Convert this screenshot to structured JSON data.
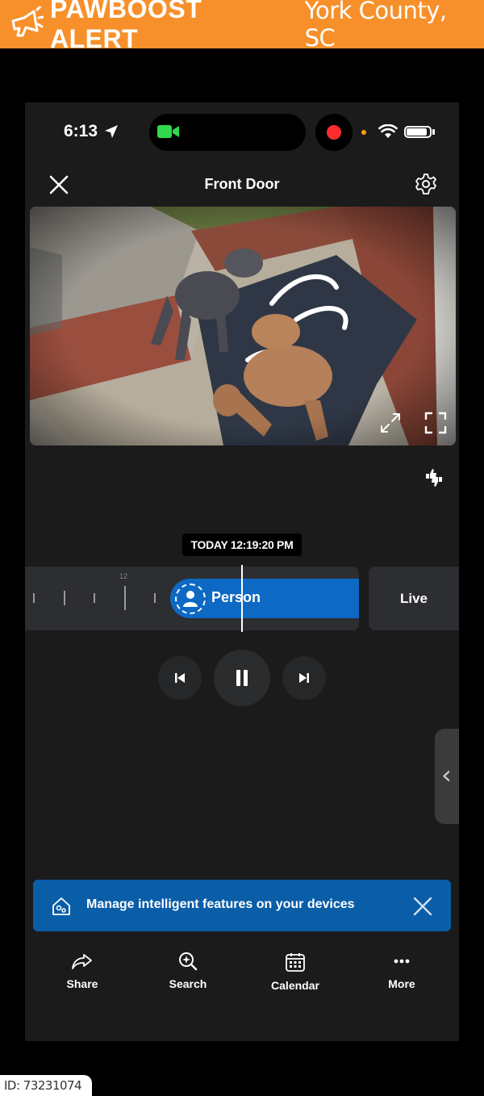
{
  "banner": {
    "brand": "PAWBOOST ALERT",
    "location": "York County, SC",
    "background": "#f7902a"
  },
  "status_bar": {
    "time": "6:13",
    "icons": [
      "location-arrow-icon",
      "facetime-camera-icon",
      "recording-dot-icon",
      "wifi-icon",
      "battery-icon"
    ]
  },
  "header": {
    "title": "Front Door",
    "close_icon": "close-icon",
    "settings_icon": "gear-icon"
  },
  "video": {
    "description_icons": [
      "expand-icon",
      "fullscreen-icon"
    ]
  },
  "feedback_icon": "thumbs-up-down-icon",
  "timeline": {
    "timestamp": "TODAY 12:19:20 PM",
    "tick_label": "12",
    "event_label": "Person",
    "live_label": "Live",
    "accent": "#0d69c4"
  },
  "playback": {
    "prev": "skip-previous-icon",
    "pause": "pause-icon",
    "next": "skip-next-icon"
  },
  "side_handle": "chevron-left-icon",
  "notice": {
    "text": "Manage intelligent features on your devices",
    "background": "#0a5ea8"
  },
  "tabs": [
    {
      "label": "Share",
      "icon": "share-icon"
    },
    {
      "label": "Search",
      "icon": "search-icon"
    },
    {
      "label": "Calendar",
      "icon": "calendar-icon"
    },
    {
      "label": "More",
      "icon": "more-icon"
    }
  ],
  "watermark_id": "ID: 73231074"
}
